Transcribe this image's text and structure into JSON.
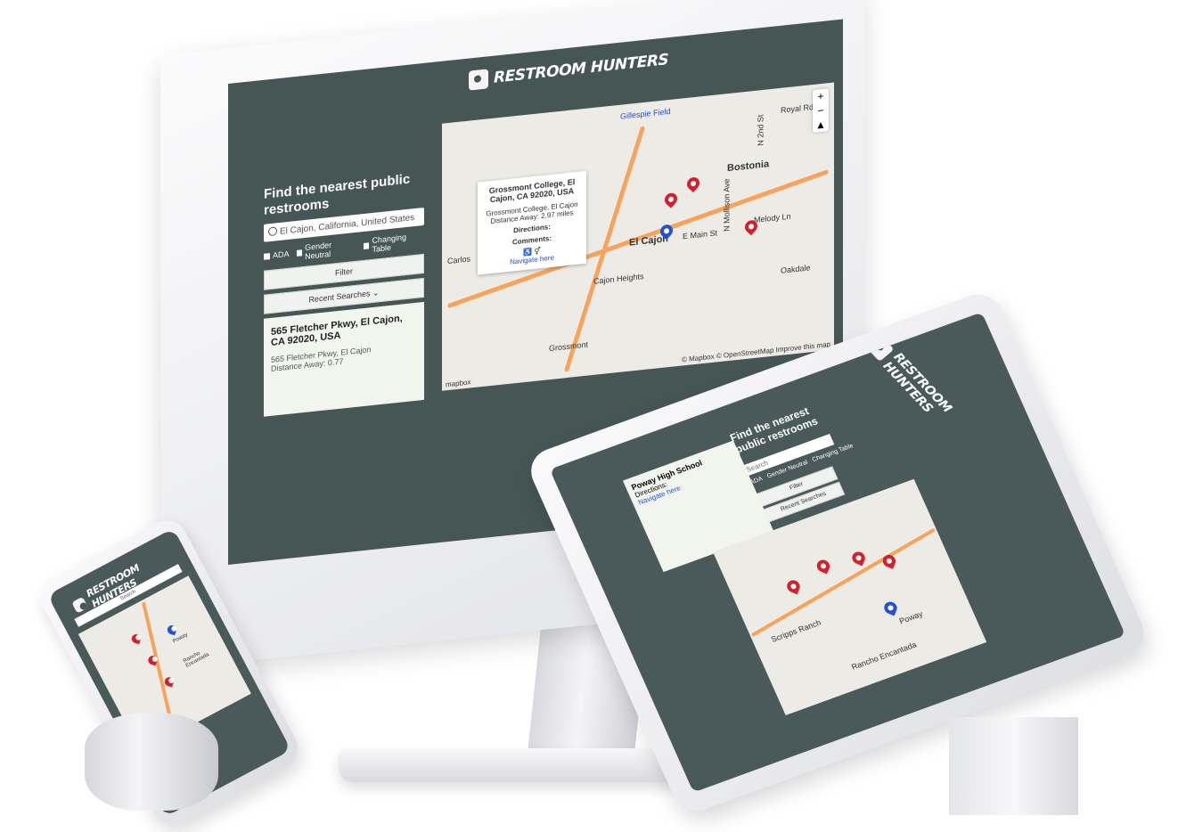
{
  "brand": {
    "name": "RESTROOM HUNTERS",
    "primary_color": "#465655",
    "pin_color": "#d61f2c",
    "current_pin_color": "#2350d6"
  },
  "desktop": {
    "heading": "Find the nearest public restrooms",
    "search_value": "El Cajon, California, United States",
    "filters": [
      "ADA",
      "Gender Neutral",
      "Changing Table"
    ],
    "filter_button": "Filter",
    "recent_searches_button": "Recent Searches",
    "result_card": {
      "title": "565 Fletcher Pkwy, El Cajon, CA 92020, USA",
      "address": "565 Fletcher Pkwy, El Cajon",
      "distance": "Distance Away: 0.77"
    },
    "map": {
      "labels": [
        "Gillespie Field",
        "Bostonia",
        "El Cajon",
        "Royal Rd",
        "N Mollison Ave",
        "N 2nd St",
        "E Main St",
        "Melody Ln",
        "Cajon Heights",
        "Grossmont",
        "Carlos",
        "Oakdale"
      ],
      "popup": {
        "title": "Grossmont College, El Cajon, CA 92020, USA",
        "subtitle": "Grossmont College, El Cajon",
        "distance": "Distance Away: 2.97 miles",
        "directions": "Directions:",
        "comments": "Comments:",
        "link": "Navigate here"
      },
      "attribution": "© Mapbox © OpenStreetMap Improve this map",
      "mapbox_logo": "mapbox",
      "zoom_in": "+",
      "zoom_out": "−"
    }
  },
  "tablet": {
    "heading": "Find the nearest public restrooms",
    "search_placeholder": "Search",
    "filters": [
      "ADA",
      "Gender Neutral",
      "Changing Table"
    ],
    "filter_button": "Filter",
    "recent_searches_button": "Recent Searches",
    "result_card": {
      "title": "Poway High School",
      "directions": "Directions:",
      "link": "Navigate here"
    },
    "map": {
      "labels": [
        "Poway",
        "Scripps Ranch",
        "Rancho Encantada"
      ]
    }
  },
  "phone": {
    "search_label": "Search",
    "map": {
      "labels": [
        "Poway",
        "Rancho Encantada"
      ]
    }
  }
}
